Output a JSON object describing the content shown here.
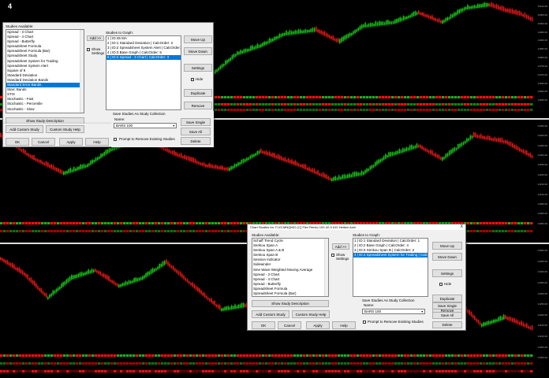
{
  "panel_number": "4",
  "axis_labels": {
    "top": [
      "15100.00",
      "15050.00",
      "15000.00",
      "14950.00",
      "14900.00",
      "14850.00",
      "14800.00",
      "14750.00",
      "14700.00",
      "14650.00",
      "14600.00",
      "14550.00"
    ],
    "mid": [
      "14450.00",
      "14400.00",
      "14350.00",
      "14300.00",
      "14250.00",
      "14200.00",
      "14150.00",
      "14100.00",
      "14050.00",
      "14000.00",
      "13950.00"
    ],
    "bot": [
      "14500.00",
      "14450.00",
      "14400.00",
      "14350.00",
      "14300.00",
      "14250.00",
      "14200.00",
      "14150.00",
      "14100.00",
      "14050.00",
      "14000.00"
    ]
  },
  "dialog1": {
    "studies_available_label": "Studies Available:",
    "studies_available": [
      "Spread - 3 Chart",
      "Spread - 4 Chart",
      "Spread - Butterfly",
      "Spreadsheet Formula",
      "Spreadsheet Formula (Bar)",
      "Spreadsheet Study",
      "Spreadsheet System for Trading",
      "Spreadsheet System Alert",
      "Square of 9",
      "Standard Deviation",
      "Standard Deviation Bands",
      "Standard Error Bands",
      "Starc Bands",
      "STIX",
      "Stochastic - Fast",
      "Stochastic - Percentile",
      "Stochastic - Slow"
    ],
    "selected_available_index": 11,
    "add_button": "Add >>",
    "show_settings": "Show Settings",
    "studies_to_graph_label": "Studies to Graph:",
    "studies_to_graph": [
      "1 | ID:45 MA",
      "2 | ID:1 Standard Deviation | CalcOrder: 2",
      "3 | ID:2 Spreadsheet System Alert | CalcOrder:",
      "4 | ID:3 Base Graph | CalcOrder: 5",
      "5 | ID:4 Spread - 3 Chart | CalcOrder: 3"
    ],
    "selected_graph_index": 4,
    "move_up": "Move Up",
    "move_down": "Move Down",
    "settings": "Settings",
    "hide": "Hide",
    "duplicate": "Duplicate",
    "remove": "Remove",
    "show_description": "Show Study Description",
    "add_custom_study": "Add Custom Study",
    "custom_study_help": "Custom Study Help",
    "save_collection_label": "Save Studies As Study Collection",
    "name_label": "Name:",
    "name_value": "BARS 100",
    "save_single": "Save Single",
    "save_all": "Save All",
    "delete": "Delete",
    "prompt_remove": "Prompt to Remove Existing Studies",
    "ok": "OK",
    "cancel": "Cancel",
    "apply": "Apply",
    "help": "Help"
  },
  "dialog2": {
    "title": "Chart Studies for: F.US.MNQM21 [C]  Flex Renko 100-42-0  #10 Heiken Ashi",
    "close": "X",
    "studies_available_label": "Studies Available:",
    "studies_available": [
      "Schaff Trend Cycle",
      "Senkou Span A",
      "Senkou Span A & B",
      "Senkou Span B",
      "Session Indicator",
      "Sidewinder",
      "Sine Wave Weighted Moving Average",
      "Spread - 3 Chart",
      "Spread - 4 Chart",
      "Spread - Butterfly",
      "Spreadsheet Formula",
      "Spreadsheet Formula (Bar)",
      "Spreadsheet Study",
      "Spreadsheet System for Trading",
      "Spreadsheet System Alert",
      "Square of 9",
      "Standard Deviation"
    ],
    "selected_available_index": 13,
    "add_button": "Add >>",
    "show_settings": "Show Settings",
    "studies_to_graph_label": "Studies to Graph:",
    "studies_to_graph": [
      "1 | ID:1 Standard Deviation | CalcOrder: 1",
      "2 | ID:2 Base Graph | CalcOrder: 4",
      "3 | ID:3 Senkou Span B | CalcOrder: 2",
      "4 | ID:4 Spreadsheet System for Trading | Calc"
    ],
    "selected_graph_index": 3,
    "move_up": "Move Up",
    "move_down": "Move Down",
    "settings": "Settings",
    "hide": "Hide",
    "duplicate": "Duplicate",
    "remove": "Remove",
    "show_description": "Show Study Description",
    "add_custom_study": "Add Custom Study",
    "custom_study_help": "Custom Study Help",
    "save_collection_label": "Save Studies As Study Collection",
    "name_label": "Name:",
    "name_value": "BARS 100",
    "save_single": "Save Single",
    "save_all": "Save All",
    "delete": "Delete",
    "prompt_remove": "Prompt to Remove Existing Studies",
    "ok": "OK",
    "cancel": "Cancel",
    "apply": "Apply",
    "help": "Help"
  },
  "colors": {
    "up_bar": "#19c219",
    "down_bar": "#e01818",
    "selection": "#0078d7",
    "chart_bg": "#000000"
  }
}
